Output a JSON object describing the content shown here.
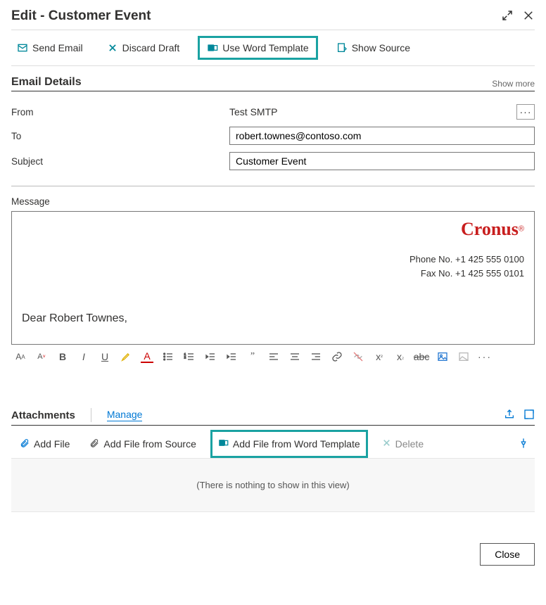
{
  "header": {
    "title": "Edit - Customer Event"
  },
  "toolbar": {
    "send_email": "Send Email",
    "discard_draft": "Discard Draft",
    "use_word_template": "Use Word Template",
    "show_source": "Show Source"
  },
  "details": {
    "section_title": "Email Details",
    "show_more": "Show more",
    "from_label": "From",
    "from_value": "Test SMTP",
    "to_label": "To",
    "to_value": "robert.townes@contoso.com",
    "subject_label": "Subject",
    "subject_value": "Customer Event"
  },
  "message": {
    "label": "Message",
    "brand": "Cronus",
    "phone_label": "Phone No.",
    "phone_value": "+1 425 555 0100",
    "fax_label": "Fax No.",
    "fax_value": "+1 425 555 0101",
    "salutation": "Dear Robert Townes,"
  },
  "attachments": {
    "title": "Attachments",
    "manage": "Manage",
    "add_file": "Add File",
    "add_source": "Add File from Source",
    "add_word": "Add File from Word Template",
    "delete": "Delete",
    "empty": "(There is nothing to show in this view)"
  },
  "footer": {
    "close": "Close"
  }
}
